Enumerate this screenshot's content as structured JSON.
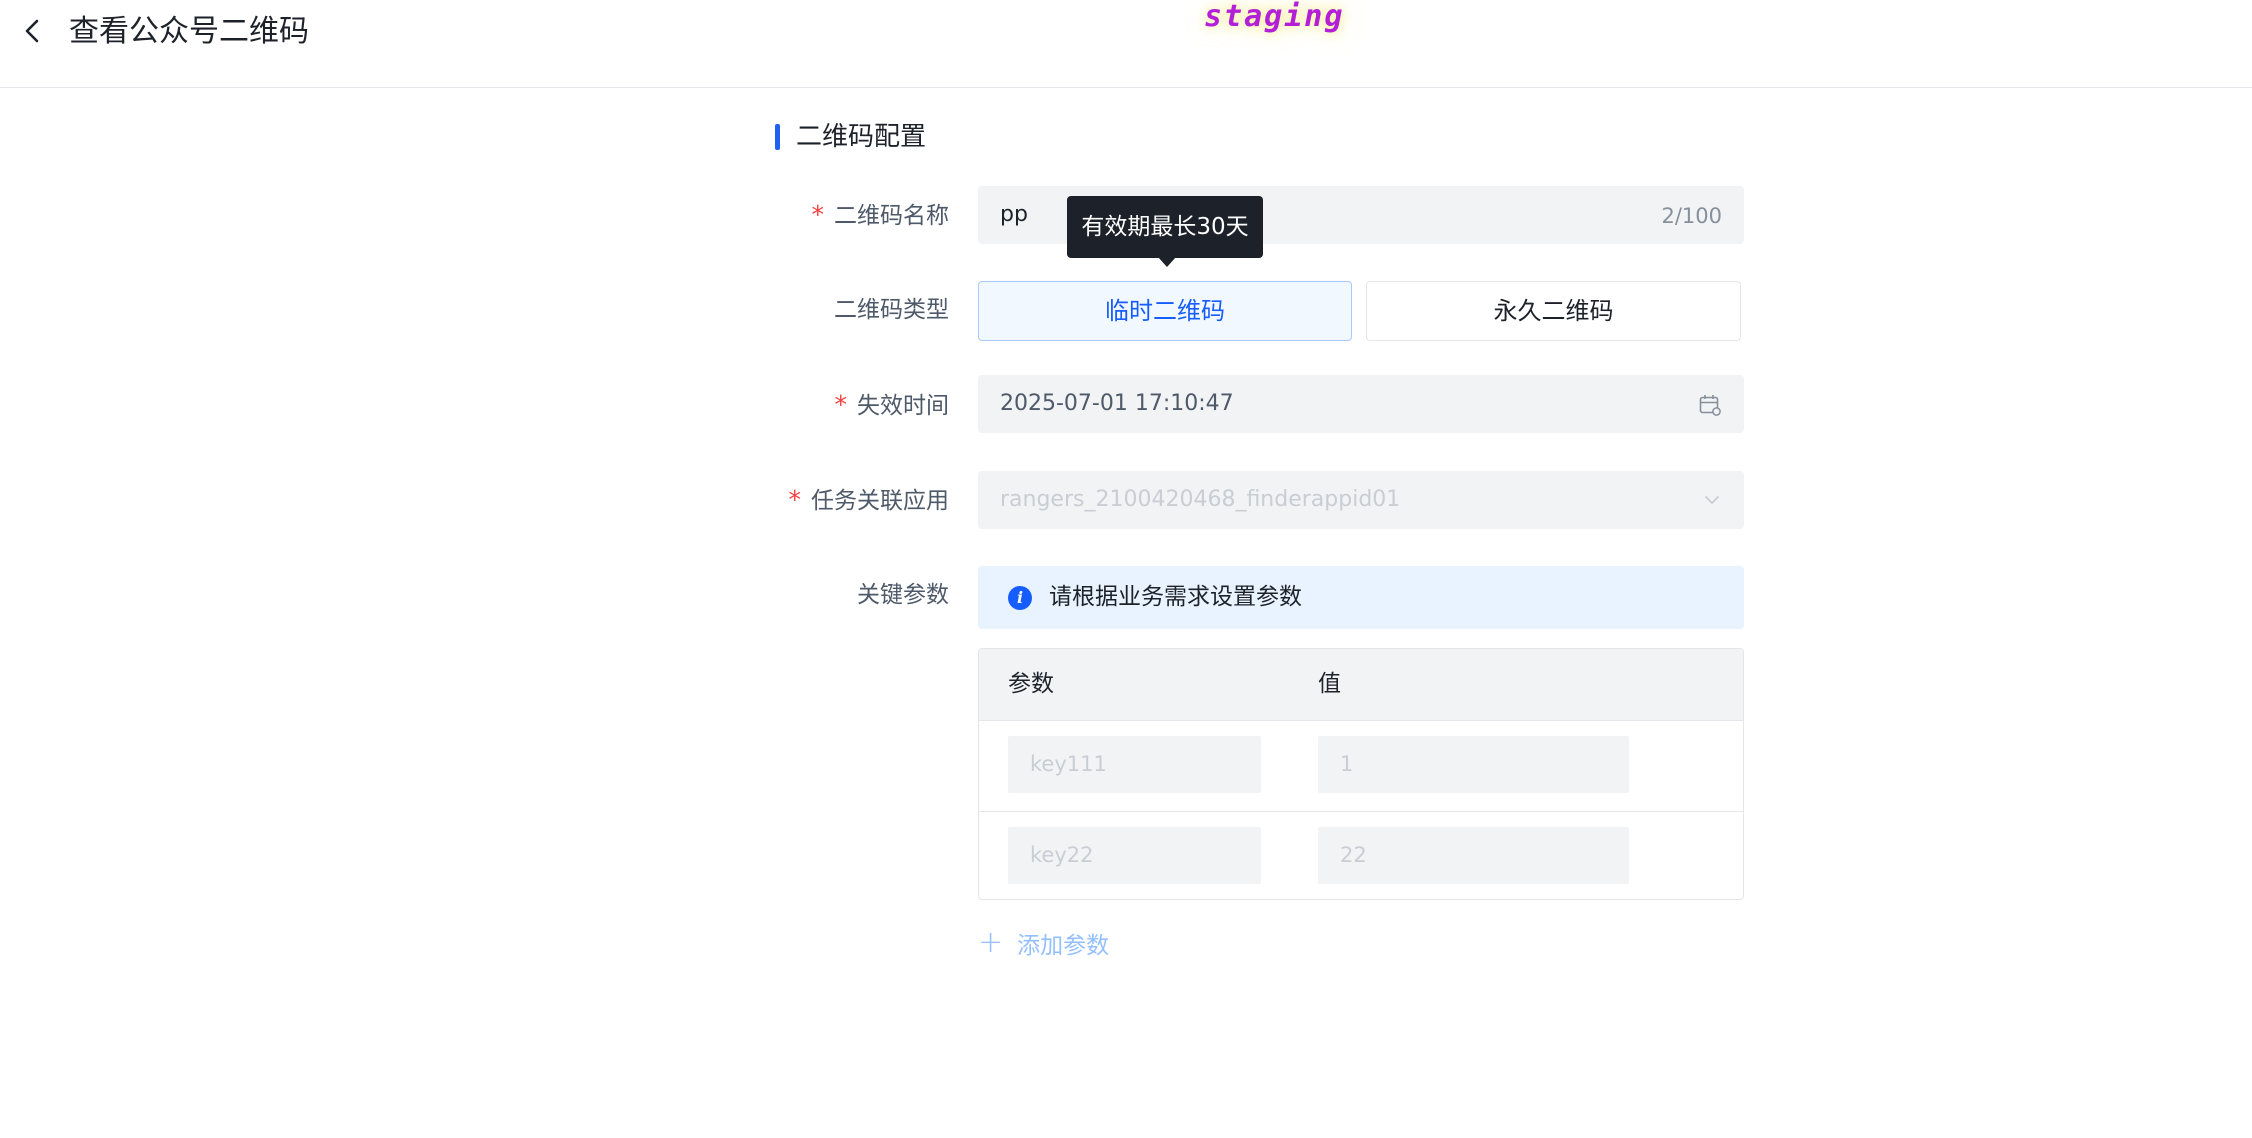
{
  "header": {
    "title": "查看公众号二维码",
    "env_badge": "staging"
  },
  "section": {
    "title": "二维码配置"
  },
  "form": {
    "name": {
      "label": "二维码名称",
      "required": true,
      "value": "pp",
      "counter": "2/100"
    },
    "type": {
      "label": "二维码类型",
      "options": [
        "临时二维码",
        "永久二维码"
      ],
      "selected": "临时二维码",
      "tooltip": "有效期最长30天"
    },
    "expire": {
      "label": "失效时间",
      "required": true,
      "value": "2025-07-01 17:10:47",
      "icon": "calendar-icon"
    },
    "app": {
      "label": "任务关联应用",
      "required": true,
      "value": "rangers_2100420468_finderappid01",
      "icon": "chevron-down-icon"
    },
    "params": {
      "label": "关键参数",
      "alert": "请根据业务需求设置参数",
      "columns": [
        "参数",
        "值"
      ],
      "rows": [
        {
          "key": "key111",
          "value": "1"
        },
        {
          "key": "key22",
          "value": "22"
        }
      ],
      "add_label": "添加参数"
    }
  },
  "colors": {
    "primary": "#1e62f0",
    "required": "#f53f3f",
    "field_bg": "#f2f3f5",
    "tooltip_bg": "#1d2129",
    "alert_bg": "#e8f3ff",
    "badge": "#b21fd6"
  }
}
